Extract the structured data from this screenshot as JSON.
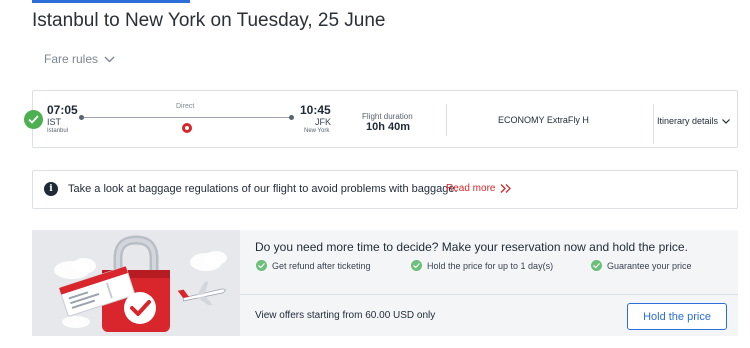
{
  "header": {
    "title": "Istanbul to New York on Tuesday, 25 June",
    "fare_rules_label": "Fare rules"
  },
  "flight": {
    "departure_time": "07:05",
    "departure_code": "IST",
    "departure_city": "Istanbul",
    "arrival_time": "10:45",
    "arrival_code": "JFK",
    "arrival_city": "New York",
    "stops_label": "Direct",
    "duration_label": "Flight duration",
    "duration_value": "10h 40m",
    "cabin_class": "ECONOMY ExtraFly H",
    "itinerary_label": "Itinerary details",
    "airline_icon": "turkish-airlines-logo-icon"
  },
  "baggage_notice": {
    "text": "Take a look at baggage regulations of our flight to avoid problems with baggage.",
    "link_label": "Read more",
    "link_color": "#d8262c"
  },
  "hold_offer": {
    "title": "Do you need more time to decide? Make your reservation now and hold the price.",
    "benefits": [
      "Get refund after ticketing",
      "Hold the price for up to 1 day(s)",
      "Guarantee your price"
    ],
    "offer_text": "View offers starting from 60.00 USD only",
    "button_label": "Hold the price",
    "accent_color": "#2d6ed8"
  },
  "colors": {
    "success": "#4caf50",
    "brand_red": "#d8262c",
    "accent_blue": "#2d6ed8"
  }
}
